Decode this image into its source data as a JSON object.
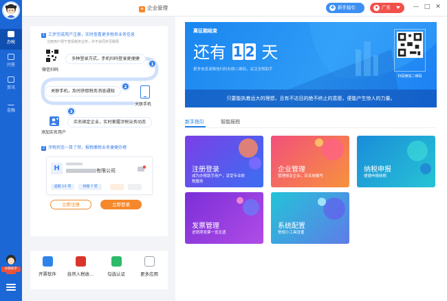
{
  "titlebar": {
    "app_title": "企业管理",
    "guide_button": "新手指引",
    "region_button": "广东",
    "minimize": "—",
    "maximize": "□",
    "close": "✕"
  },
  "sidebar": {
    "items": [
      {
        "label": "办税"
      },
      {
        "label": "问答"
      },
      {
        "label": "资讯"
      },
      {
        "label": "金融"
      }
    ],
    "helper_label": "办税助手"
  },
  "left_panel": {
    "step1_title": "三步完成用户注册，实时查看更多税务业务信息",
    "step1_sub": "注册用户便于查看税务业务，并不会同步至税局",
    "wechat_label": "微信扫码",
    "bubble1": "多种登录方式，手机扫码登录更便捷",
    "bubble2": "关联手机，及时获取税务消息通知",
    "phone_label": "关联手机",
    "bubble3": "实名绑定企业，实时掌握涉税业务动态",
    "add_user_label": "添加实名用户",
    "step2_title": "涉税状态一目了然，报税缴税业务便捷办理",
    "card_letter": "H",
    "company_name": "有限公司",
    "chips": [
      "逾期 10 项",
      "待缴 7 项",
      "  ",
      "  "
    ],
    "register_button": "立即注册",
    "login_button": "立即登录",
    "step_numbers": [
      "1",
      "2",
      "3"
    ],
    "step_heads": [
      "1",
      "2"
    ]
  },
  "quick_apps": [
    {
      "label": "开票软件",
      "icon": "invoice-software-icon",
      "color": "#2f84ea"
    },
    {
      "label": "自然人税收...",
      "icon": "natural-person-tax-icon",
      "color": "#d9352b"
    },
    {
      "label": "勾选认证",
      "icon": "checkbox-certify-icon",
      "color": "#2dbb6a"
    },
    {
      "label": "更多应用",
      "icon": "more-apps-icon",
      "color": "#9aa3ad"
    }
  ],
  "banner": {
    "small_title": "离征期结束",
    "prefix": "还有",
    "digits": [
      "1",
      "2"
    ],
    "suffix": "天",
    "subtitle": "更多信息请微信扫码右侧二维码，关注全税助手",
    "qr_label": "扫码微信二维码",
    "bottom_text": "只要能执着远大的理想，且有不达目的绝不终止的意愿，便能产生惊人的力量。"
  },
  "tabs": [
    {
      "label": "新手指引",
      "active": true
    },
    {
      "label": "智能报税",
      "active": false
    }
  ],
  "tiles": [
    {
      "title": "注册登录",
      "sub": "成为办税助手用户，享受专业财税服务",
      "c1": "#7b3fe6",
      "c2": "#3b6ff2"
    },
    {
      "title": "企业管理",
      "sub": "管理绑定企业，实名制缴号",
      "c1": "#f2507a",
      "c2": "#f7923e"
    },
    {
      "title": "纳税申报",
      "sub": "便捷申报纳税",
      "c1": "#1a8cd8",
      "c2": "#27c4d6"
    },
    {
      "title": "发票管理",
      "sub": "进销项发票一览无遗",
      "c1": "#7a2fd8",
      "c2": "#b14ce6"
    },
    {
      "title": "系统配置",
      "sub": "常规小工具设置",
      "c1": "#23c3d8",
      "c2": "#5f7ce8"
    }
  ]
}
